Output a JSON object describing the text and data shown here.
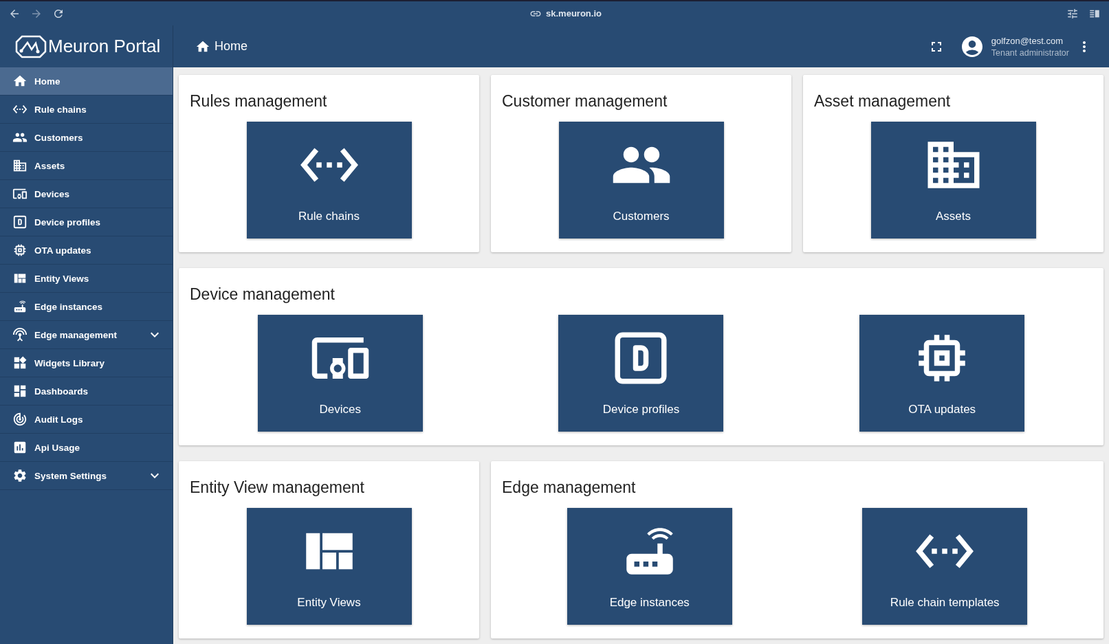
{
  "browser": {
    "url": "sk.meuron.io"
  },
  "header": {
    "title": "Meuron Portal",
    "breadcrumb": "Home",
    "user": {
      "email": "golfzon@test.com",
      "role": "Tenant administrator"
    }
  },
  "sidebar": {
    "items": [
      {
        "label": "Home",
        "kind": "link",
        "selected": true
      },
      {
        "label": "Rule chains",
        "kind": "link",
        "selected": false
      },
      {
        "label": "Customers",
        "kind": "link",
        "selected": false
      },
      {
        "label": "Assets",
        "kind": "link",
        "selected": false
      },
      {
        "label": "Devices",
        "kind": "link",
        "selected": false
      },
      {
        "label": "Device profiles",
        "kind": "link",
        "selected": false
      },
      {
        "label": "OTA updates",
        "kind": "link",
        "selected": false
      },
      {
        "label": "Entity Views",
        "kind": "link",
        "selected": false
      },
      {
        "label": "Edge instances",
        "kind": "link",
        "selected": false
      },
      {
        "label": "Edge management",
        "kind": "group",
        "selected": false,
        "expanded": false
      },
      {
        "label": "Widgets Library",
        "kind": "link",
        "selected": false
      },
      {
        "label": "Dashboards",
        "kind": "link",
        "selected": false
      },
      {
        "label": "Audit Logs",
        "kind": "link",
        "selected": false
      },
      {
        "label": "Api Usage",
        "kind": "link",
        "selected": false
      },
      {
        "label": "System Settings",
        "kind": "group",
        "selected": false,
        "expanded": false
      }
    ]
  },
  "sections": [
    {
      "title": "Rules management",
      "tiles": [
        {
          "label": "Rule chains"
        }
      ]
    },
    {
      "title": "Customer management",
      "tiles": [
        {
          "label": "Customers"
        }
      ]
    },
    {
      "title": "Asset management",
      "tiles": [
        {
          "label": "Assets"
        }
      ]
    },
    {
      "title": "Device management",
      "tiles": [
        {
          "label": "Devices"
        },
        {
          "label": "Device profiles"
        },
        {
          "label": "OTA updates"
        }
      ]
    },
    {
      "title": "Entity View management",
      "tiles": [
        {
          "label": "Entity Views"
        }
      ]
    },
    {
      "title": "Edge management",
      "tiles": [
        {
          "label": "Edge instances"
        },
        {
          "label": "Rule chain templates"
        }
      ]
    }
  ]
}
